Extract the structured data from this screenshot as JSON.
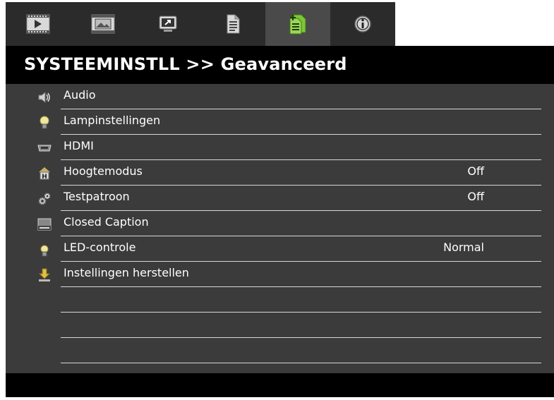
{
  "tabs": [
    {
      "icon": "image-icon"
    },
    {
      "icon": "screen-icon"
    },
    {
      "icon": "setup-icon"
    },
    {
      "icon": "document-icon"
    },
    {
      "icon": "advanced-settings-icon",
      "active": true
    },
    {
      "icon": "info-icon"
    }
  ],
  "header": {
    "title": "SYSTEEMINSTLL >> Geavanceerd"
  },
  "menu": [
    {
      "label": "Audio",
      "value": "",
      "icon": "speaker-icon"
    },
    {
      "label": "Lampinstellingen",
      "value": "",
      "icon": "lamp-icon"
    },
    {
      "label": "HDMI",
      "value": "",
      "icon": "hdmi-icon"
    },
    {
      "label": "Hoogtemodus",
      "value": "Off",
      "icon": "altitude-icon"
    },
    {
      "label": "Testpatroon",
      "value": "Off",
      "icon": "test-pattern-icon"
    },
    {
      "label": "Closed Caption",
      "value": "",
      "icon": "caption-icon"
    },
    {
      "label": "LED-controle",
      "value": "Normal",
      "icon": "led-icon"
    },
    {
      "label": "Instellingen herstellen",
      "value": "",
      "icon": "reset-icon"
    },
    {
      "label": "",
      "value": ""
    },
    {
      "label": "",
      "value": ""
    },
    {
      "label": "",
      "value": ""
    }
  ],
  "colors": {
    "accent": "#7cc63a",
    "panel": "#3b3b3b",
    "tab": "#2b2b2b",
    "active_tab": "#4a4a4a"
  }
}
